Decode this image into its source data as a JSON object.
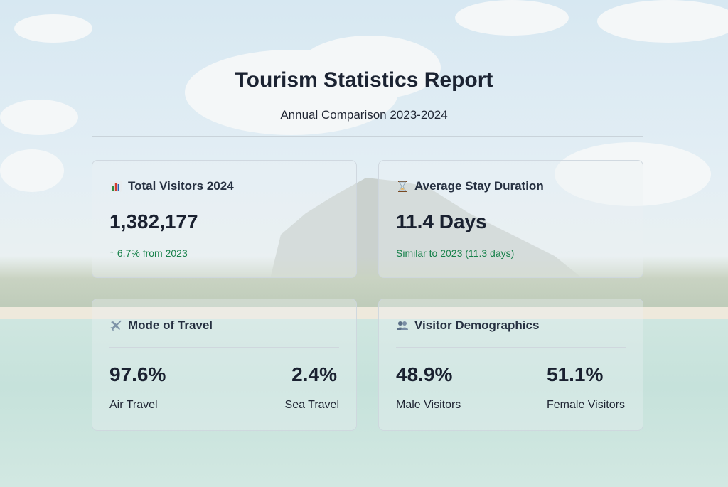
{
  "header": {
    "title": "Tourism Statistics Report",
    "subtitle": "Annual Comparison 2023-2024"
  },
  "cards": {
    "total_visitors": {
      "icon": "bar-chart-icon",
      "title": "Total Visitors 2024",
      "value": "1,382,177",
      "note": "↑ 6.7% from 2023"
    },
    "stay_duration": {
      "icon": "hourglass-icon",
      "title": "Average Stay Duration",
      "value": "11.4 Days",
      "note": "Similar to 2023 (11.3 days)"
    },
    "travel_mode": {
      "icon": "airplane-icon",
      "title": "Mode of Travel",
      "stats": [
        {
          "value": "97.6%",
          "label": "Air Travel"
        },
        {
          "value": "2.4%",
          "label": "Sea Travel"
        }
      ]
    },
    "demographics": {
      "icon": "people-icon",
      "title": "Visitor Demographics",
      "stats": [
        {
          "value": "48.9%",
          "label": "Male Visitors"
        },
        {
          "value": "51.1%",
          "label": "Female Visitors"
        }
      ]
    }
  },
  "colors": {
    "positive": "#17814a",
    "text": "#1a2130"
  }
}
